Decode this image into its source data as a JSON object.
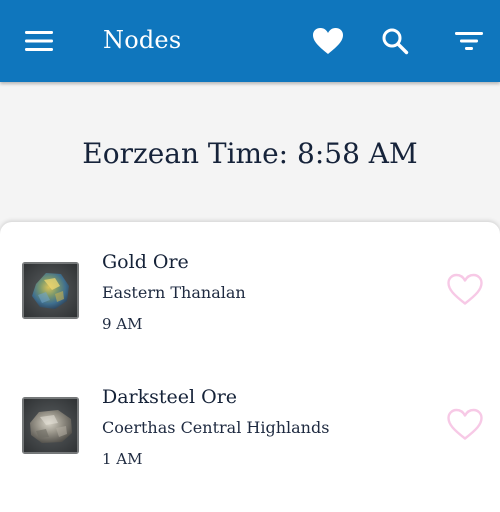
{
  "appbar": {
    "title": "Nodes",
    "menu_icon": "menu-icon",
    "favorites_icon": "heart-icon",
    "search_icon": "search-icon",
    "filter_icon": "filter-icon",
    "background_color": "#0f76bd"
  },
  "clock": {
    "text": "Eorzean Time: 8:58 AM"
  },
  "nodes": [
    {
      "name": "Gold Ore",
      "zone": "Eastern Thanalan",
      "time": "9 AM",
      "icon": "gold-ore-icon",
      "favorite_icon": "heart-outline-icon"
    },
    {
      "name": "Darksteel Ore",
      "zone": "Coerthas Central Highlands",
      "time": "1 AM",
      "icon": "darksteel-ore-icon",
      "favorite_icon": "heart-outline-icon"
    }
  ],
  "colors": {
    "favorite_outline": "#f7c9e6"
  }
}
